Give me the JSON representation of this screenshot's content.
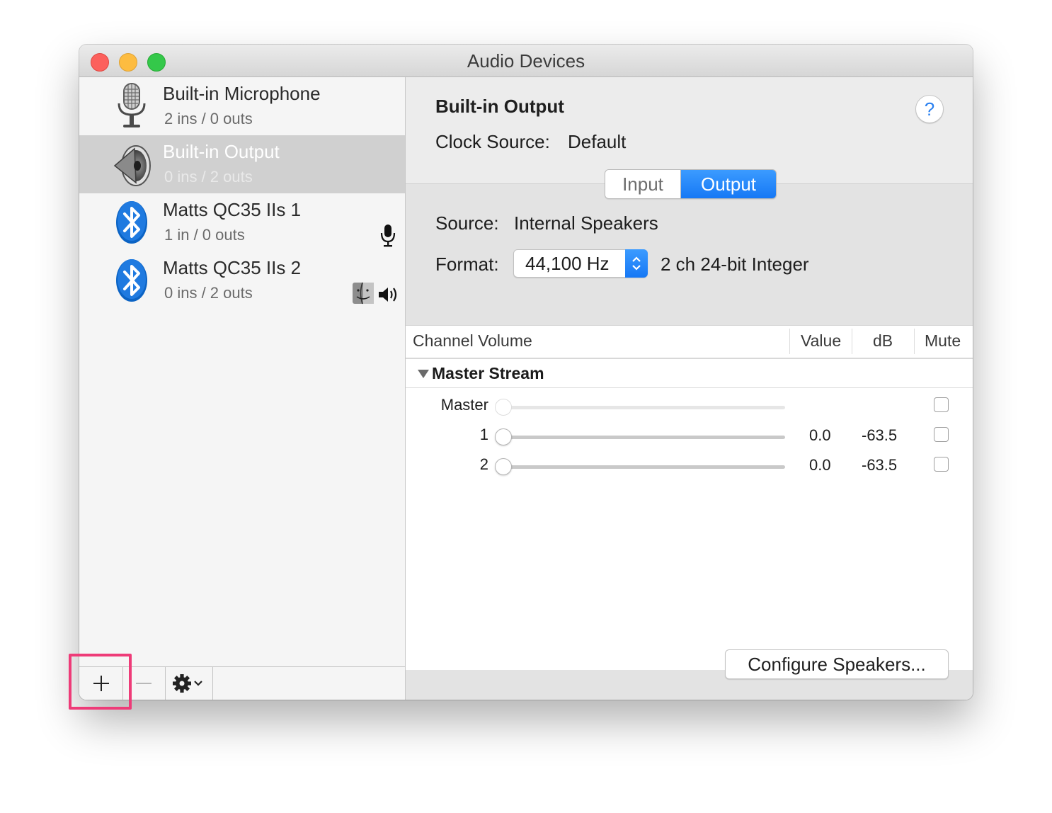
{
  "window": {
    "title": "Audio Devices"
  },
  "sidebar": {
    "devices": [
      {
        "name": "Built-in Microphone",
        "io": "2 ins / 0 outs",
        "icon": "microphone-icon",
        "selected": false
      },
      {
        "name": "Built-in Output",
        "io": "0 ins / 2 outs",
        "icon": "speaker-icon",
        "selected": true
      },
      {
        "name": "Matts QC35 IIs 1",
        "io": "1 in / 0 outs",
        "icon": "bluetooth-icon",
        "badges": [
          "mic-icon"
        ]
      },
      {
        "name": "Matts QC35 IIs 2",
        "io": "0 ins / 2 outs",
        "icon": "bluetooth-icon",
        "badges": [
          "finder-icon",
          "volume-icon"
        ]
      }
    ],
    "toolbar": {
      "add": "+",
      "remove": "—",
      "gear": "gear-icon"
    }
  },
  "detail": {
    "device_title": "Built-in Output",
    "help": "?",
    "clock_source_label": "Clock Source:",
    "clock_source_value": "Default",
    "tabs": [
      {
        "label": "Input",
        "selected": false
      },
      {
        "label": "Output",
        "selected": true
      }
    ],
    "source_label": "Source:",
    "source_value": "Internal Speakers",
    "format_label": "Format:",
    "format_value": "44,100 Hz",
    "format_extra": "2 ch 24-bit Integer",
    "table": {
      "headers": {
        "channel_volume": "Channel Volume",
        "value": "Value",
        "db": "dB",
        "mute": "Mute"
      },
      "group": "Master Stream",
      "rows": [
        {
          "label": "Master",
          "value": "",
          "db": "",
          "mute": false,
          "enabled": false,
          "level": 0
        },
        {
          "label": "1",
          "value": "0.0",
          "db": "-63.5",
          "mute": false,
          "enabled": true,
          "level": 0
        },
        {
          "label": "2",
          "value": "0.0",
          "db": "-63.5",
          "mute": false,
          "enabled": true,
          "level": 0
        }
      ]
    },
    "configure_button": "Configure Speakers..."
  },
  "colors": {
    "accent": "#1678f5",
    "selection": "#d0d0d0",
    "highlight_box": "#ee3b78"
  }
}
